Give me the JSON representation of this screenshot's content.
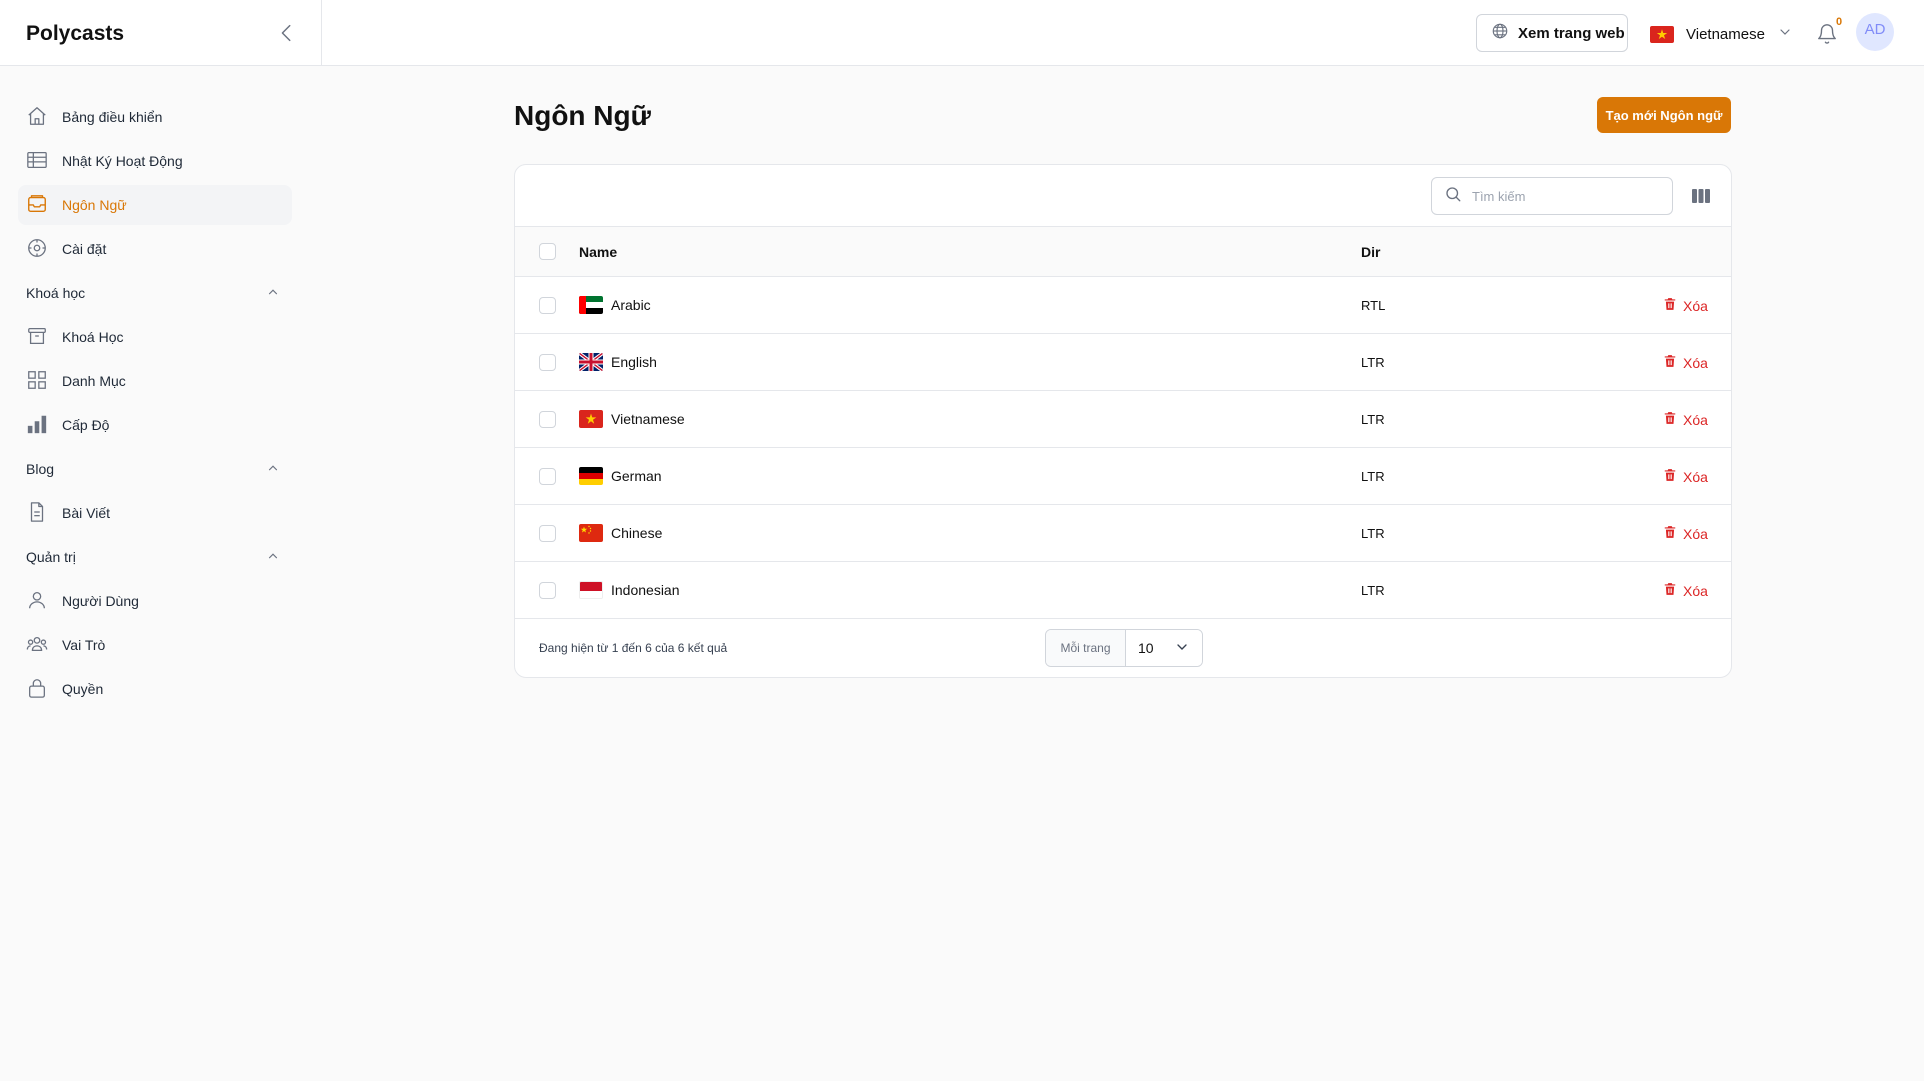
{
  "app": {
    "brand": "Polycasts"
  },
  "header": {
    "view_site_label": "Xem trang web",
    "language_label": "Vietnamese",
    "notification_count": "0",
    "avatar_initials": "AD"
  },
  "sidebar": {
    "top_items": [
      {
        "label": "Bảng điều khiển",
        "icon": "home-icon"
      },
      {
        "label": "Nhật Ký Hoạt Động",
        "icon": "table-icon"
      },
      {
        "label": "Ngôn Ngữ",
        "icon": "inbox-icon",
        "active": true
      },
      {
        "label": "Cài đặt",
        "icon": "gear-icon"
      }
    ],
    "groups": [
      {
        "label": "Khoá học",
        "items": [
          {
            "label": "Khoá Học",
            "icon": "archive-icon"
          },
          {
            "label": "Danh Mục",
            "icon": "grid-icon"
          },
          {
            "label": "Cấp Độ",
            "icon": "bar-chart-icon"
          }
        ]
      },
      {
        "label": "Blog",
        "items": [
          {
            "label": "Bài Viết",
            "icon": "document-icon"
          }
        ]
      },
      {
        "label": "Quản trị",
        "items": [
          {
            "label": "Người Dùng",
            "icon": "user-icon"
          },
          {
            "label": "Vai Trò",
            "icon": "users-icon"
          },
          {
            "label": "Quyền",
            "icon": "lock-icon"
          }
        ]
      }
    ]
  },
  "main": {
    "title": "Ngôn Ngữ",
    "create_button": "Tạo mới Ngôn ngữ",
    "search_placeholder": "Tìm kiếm",
    "columns": {
      "name": "Name",
      "dir": "Dir"
    },
    "rows": [
      {
        "name": "Arabic",
        "dir": "RTL",
        "flag": "ae",
        "delete": "Xóa"
      },
      {
        "name": "English",
        "dir": "LTR",
        "flag": "gb",
        "delete": "Xóa"
      },
      {
        "name": "Vietnamese",
        "dir": "LTR",
        "flag": "vn",
        "delete": "Xóa"
      },
      {
        "name": "German",
        "dir": "LTR",
        "flag": "de",
        "delete": "Xóa"
      },
      {
        "name": "Chinese",
        "dir": "LTR",
        "flag": "cn",
        "delete": "Xóa"
      },
      {
        "name": "Indonesian",
        "dir": "LTR",
        "flag": "id",
        "delete": "Xóa"
      }
    ],
    "footer_text": "Đang hiện từ 1 đến 6 của 6 kết quả",
    "per_page_label": "Mỗi trang",
    "per_page_value": "10"
  },
  "colors": {
    "accent": "#d97706",
    "danger": "#dc2626",
    "border": "#e5e7eb"
  }
}
